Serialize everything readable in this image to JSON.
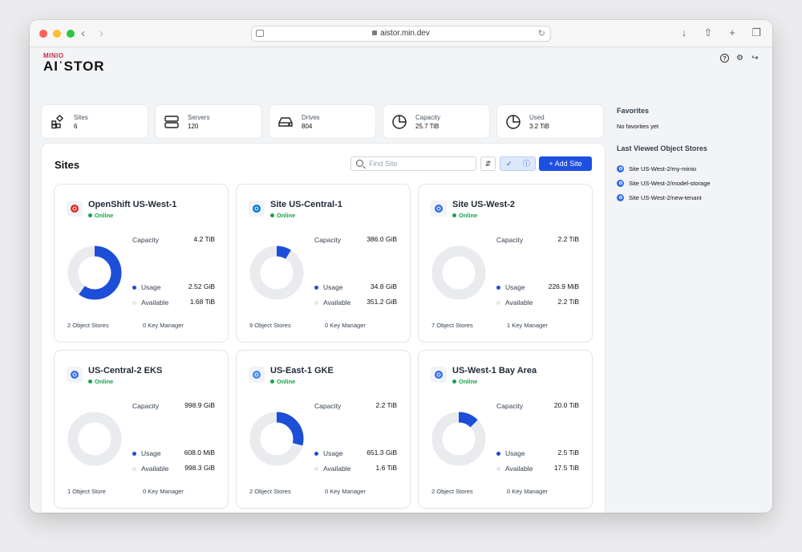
{
  "browser": {
    "url": "aistor.min.dev",
    "back_icon": "chevron-left-icon",
    "forward_icon": "chevron-right-icon"
  },
  "brand": {
    "top": "MINIO",
    "main": "AIˈSTOR"
  },
  "stats": [
    {
      "label": "Sites",
      "value": "6",
      "icon": "grid-icon"
    },
    {
      "label": "Servers",
      "value": "120",
      "icon": "server-icon"
    },
    {
      "label": "Drives",
      "value": "804",
      "icon": "drive-icon"
    },
    {
      "label": "Capacity",
      "value": "25.7 TiB",
      "icon": "pie-icon"
    },
    {
      "label": "Used",
      "value": "3.2 TiB",
      "icon": "pie-icon"
    }
  ],
  "sites": {
    "title": "Sites",
    "search_placeholder": "Find Site",
    "add_label": "Add Site",
    "capacity_label": "Capacity",
    "usage_label": "Usage",
    "available_label": "Available",
    "cards": [
      {
        "name": "OpenShift US-West-1",
        "status": "Online",
        "capacity": "4.2 TiB",
        "usage": "2.52 GiB",
        "available": "1.68 TiB",
        "used_fraction": 0.6,
        "stores": "2 Object Stores",
        "keys": "0 Key Manager",
        "icon": "openshift-icon",
        "icon_color": "#dc2626"
      },
      {
        "name": "Site US-Central-1",
        "status": "Online",
        "capacity": "386.0 GiB",
        "usage": "34.8 GiB",
        "available": "351.2 GiB",
        "used_fraction": 0.09,
        "stores": "9 Object Stores",
        "keys": "0 Key Manager",
        "icon": "azure-icon",
        "icon_color": "#0078d4"
      },
      {
        "name": "Site US-West-2",
        "status": "Online",
        "capacity": "2.2 TiB",
        "usage": "226.9 MiB",
        "available": "2.2 TiB",
        "used_fraction": 0.0,
        "stores": "7 Object Stores",
        "keys": "1 Key Manager",
        "icon": "kubernetes-icon",
        "icon_color": "#326ce5"
      },
      {
        "name": "US-Central-2 EKS",
        "status": "Online",
        "capacity": "998.9 GiB",
        "usage": "608.0 MiB",
        "available": "998.3 GiB",
        "used_fraction": 0.0,
        "stores": "1 Object Store",
        "keys": "0 Key Manager",
        "icon": "kubernetes-icon",
        "icon_color": "#326ce5"
      },
      {
        "name": "US-East-1 GKE",
        "status": "Online",
        "capacity": "2.2 TiB",
        "usage": "651.3 GiB",
        "available": "1.6 TiB",
        "used_fraction": 0.29,
        "stores": "2 Object Stores",
        "keys": "0 Key Manager",
        "icon": "gke-icon",
        "icon_color": "#4285f4"
      },
      {
        "name": "US-West-1 Bay Area",
        "status": "Online",
        "capacity": "20.0 TiB",
        "usage": "2.5 TiB",
        "available": "17.5 TiB",
        "used_fraction": 0.125,
        "stores": "2 Object Stores",
        "keys": "0 Key Manager",
        "icon": "kubernetes-icon",
        "icon_color": "#326ce5"
      }
    ]
  },
  "sidebar": {
    "favorites_title": "Favorites",
    "favorites_empty": "No favorites yet",
    "last_viewed_title": "Last Viewed Object Stores",
    "last_viewed": [
      "Site US-West-2/my-minio",
      "Site US-West-2/model-storage",
      "Site US-West-2/new-tenant"
    ]
  },
  "colors": {
    "accent": "#1d4fe0",
    "usage": "#1d4ed8",
    "track": "#e9ebef",
    "online": "#16a34a"
  }
}
